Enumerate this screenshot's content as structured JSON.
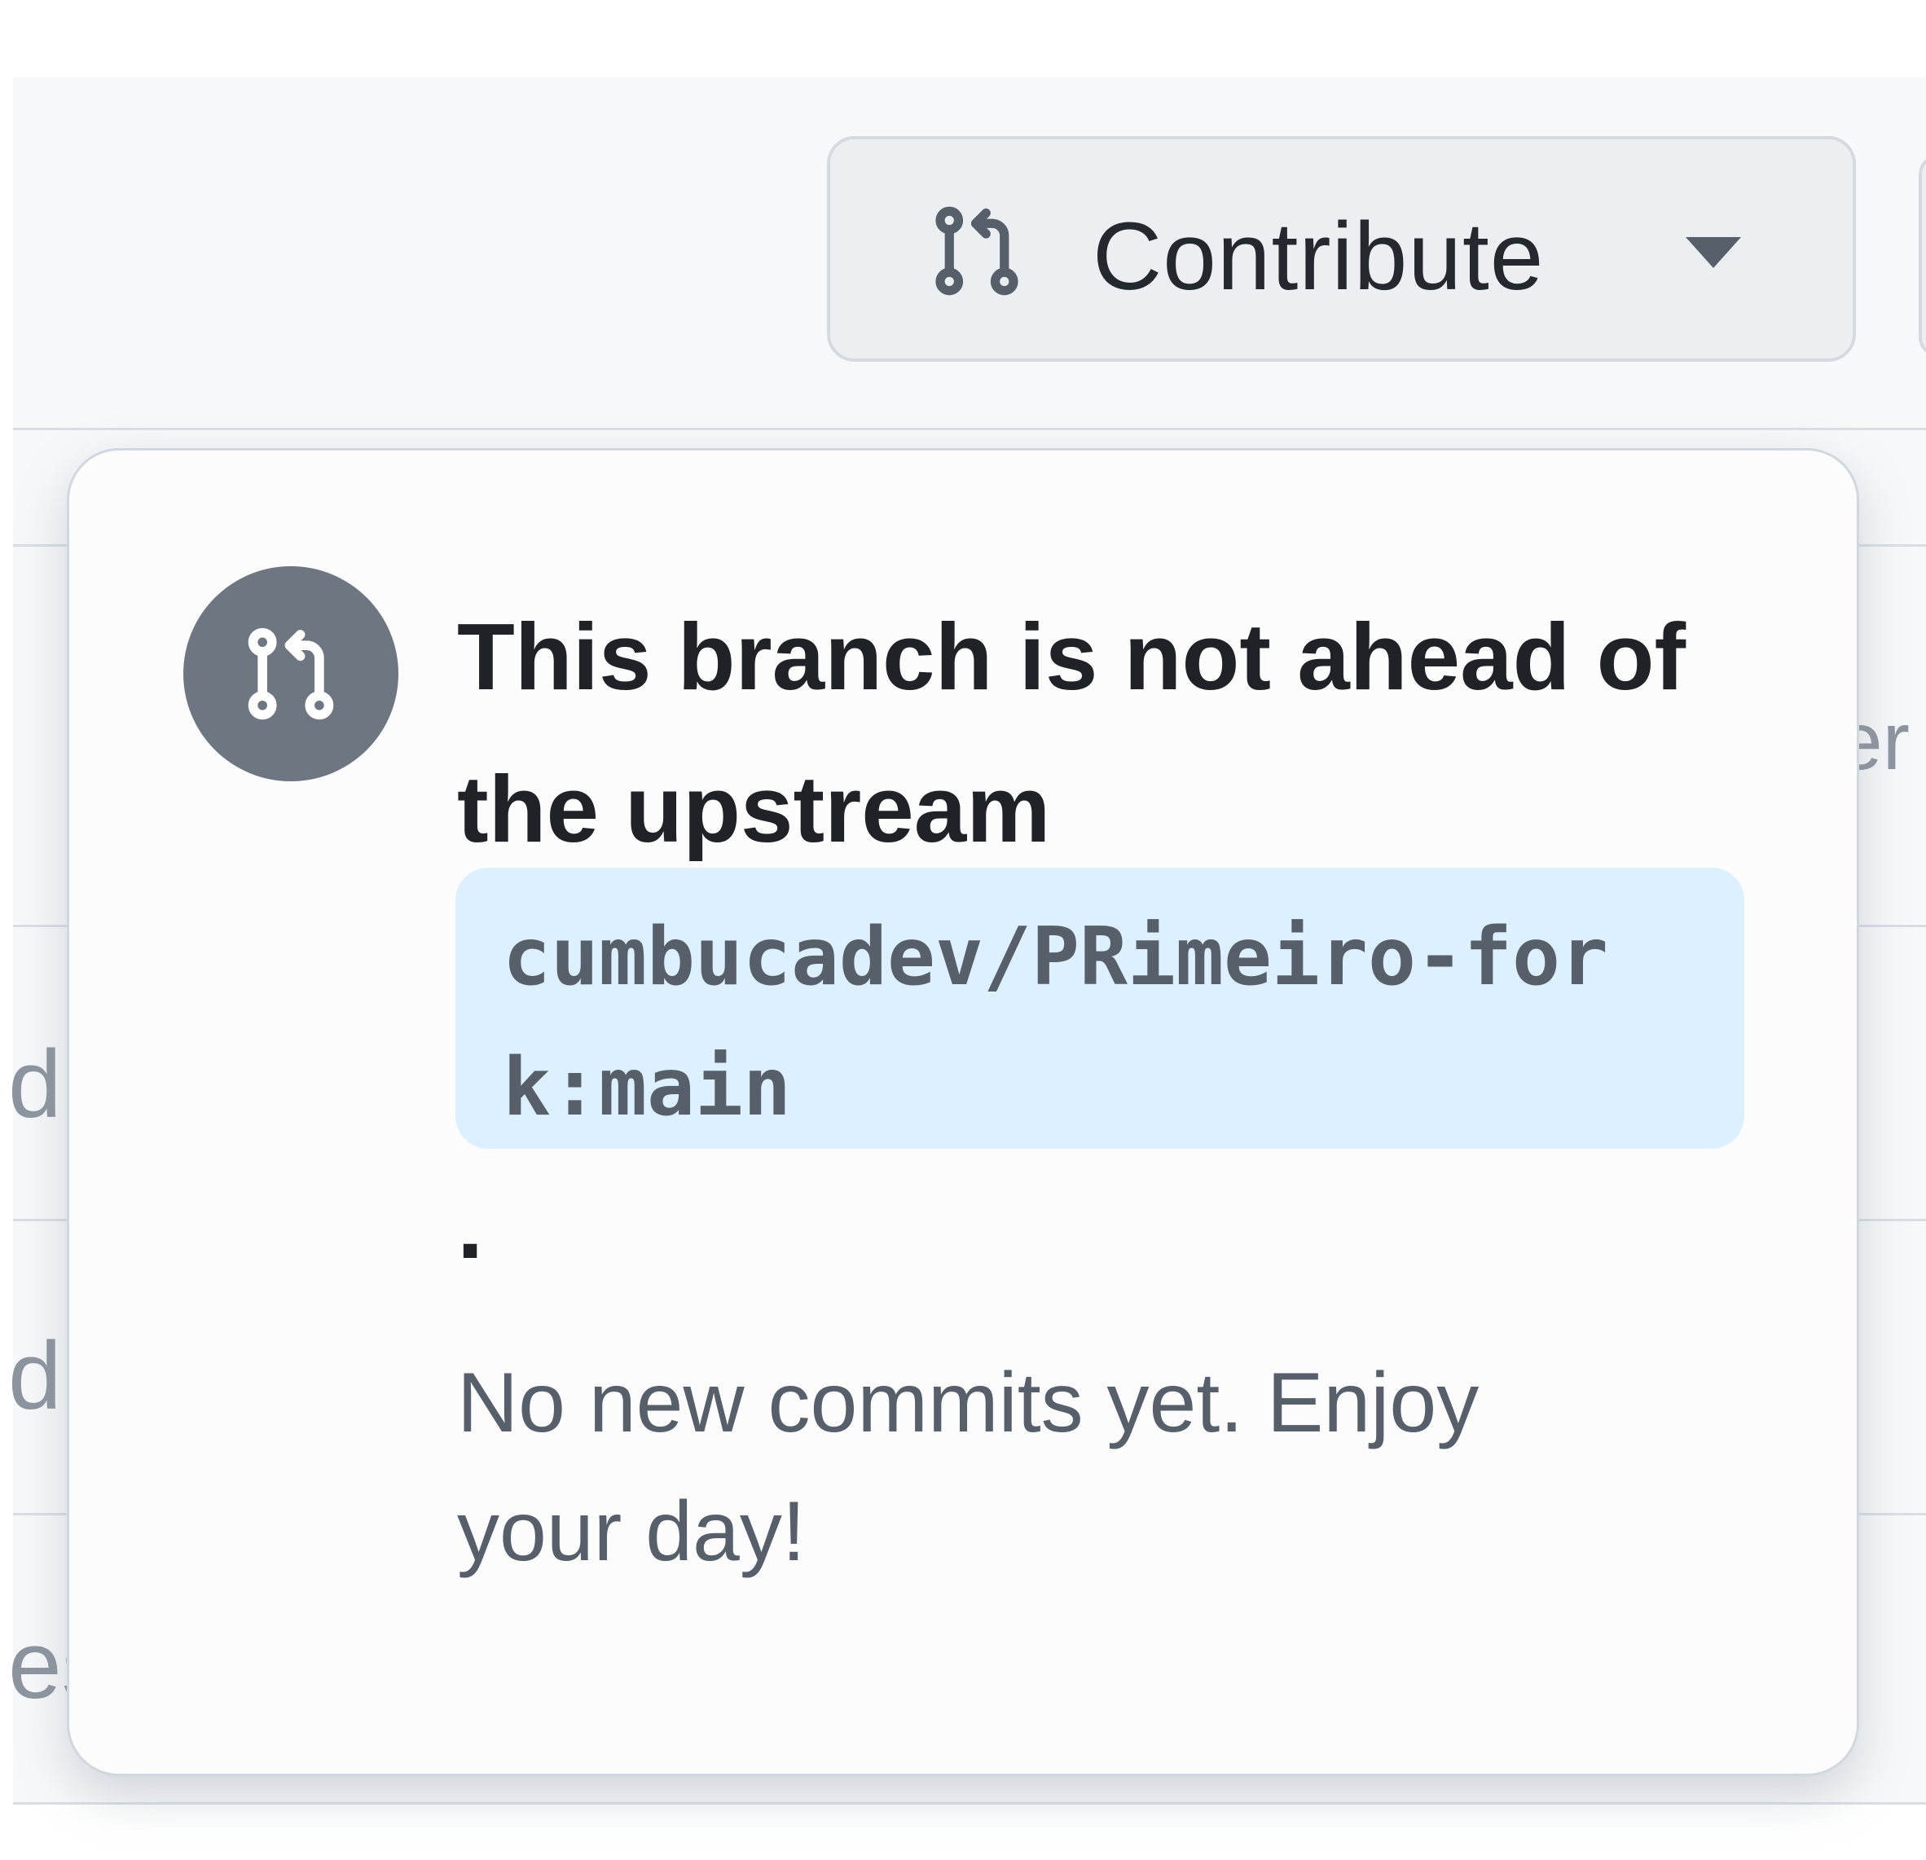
{
  "toolbar": {
    "contribute_label": "Contribute",
    "contribute_icon": "git-pull-request-icon",
    "caret_icon": "triangle-down-icon"
  },
  "background": {
    "fragments": [
      "er",
      "d",
      "d",
      "es"
    ]
  },
  "popover": {
    "icon": "git-pull-request-icon",
    "title": "This branch is not ahead of the upstream",
    "branch_ref": "cumbucadev/PRimeiro-fork:main",
    "trailing_punctuation": ".",
    "description": "No new commits yet. Enjoy your day!"
  },
  "colors": {
    "button_bg": "#eceff2",
    "avatar_bg": "#6e7781",
    "branch_bg": "#ddf0ff",
    "title_text": "#1f2328",
    "muted_text": "#57606a"
  }
}
